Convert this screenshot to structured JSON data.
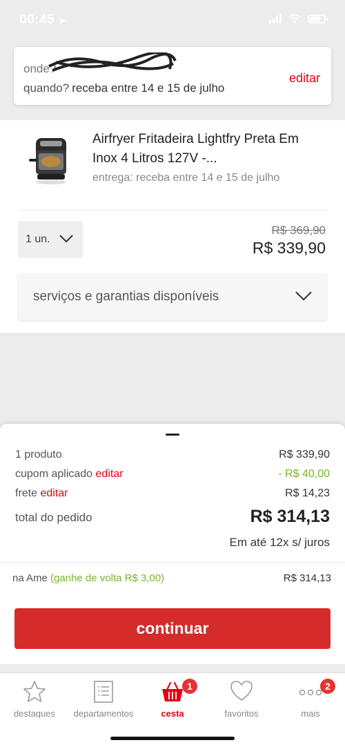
{
  "status_bar": {
    "time": "00:45"
  },
  "delivery": {
    "where_label": "onde?",
    "when_label": "quando?",
    "when_value": "receba entre 14 e 15 de julho",
    "edit_label": "editar"
  },
  "product": {
    "title": "Airfryer Fritadeira Lightfry Preta Em Inox 4 Litros 127V -...",
    "delivery_text": "entrega: receba entre 14 e 15 de julho",
    "quantity": "1 un.",
    "old_price": "R$ 369,90",
    "price": "R$ 339,90",
    "services_label": "serviços e garantias disponíveis"
  },
  "summary": {
    "products_label": "1 produto",
    "products_value": "R$ 339,90",
    "coupon_label": "cupom aplicado",
    "coupon_edit": "editar",
    "coupon_value": "- R$ 40,00",
    "shipping_label": "frete",
    "shipping_edit": "editar",
    "shipping_value": "R$ 14,23",
    "total_label": "total do pedido",
    "total_value": "R$ 314,13",
    "installments": "Em até 12x s/ juros"
  },
  "ame": {
    "label": "na Ame",
    "cashback": "(ganhe de volta R$ 3,00)",
    "value": "R$ 314,13"
  },
  "cta": {
    "continue_label": "continuar"
  },
  "tabs": [
    {
      "label": "destaques",
      "icon": "star-icon"
    },
    {
      "label": "departamentos",
      "icon": "list-icon"
    },
    {
      "label": "cesta",
      "icon": "basket-icon",
      "badge": "1",
      "active": true
    },
    {
      "label": "favoritos",
      "icon": "heart-icon"
    },
    {
      "label": "mais",
      "icon": "more-icon",
      "badge": "2"
    }
  ],
  "colors": {
    "brand_red": "#e60014",
    "button_red": "#d52b2b",
    "discount_green": "#7ab52a",
    "badge_red": "#e53333"
  }
}
